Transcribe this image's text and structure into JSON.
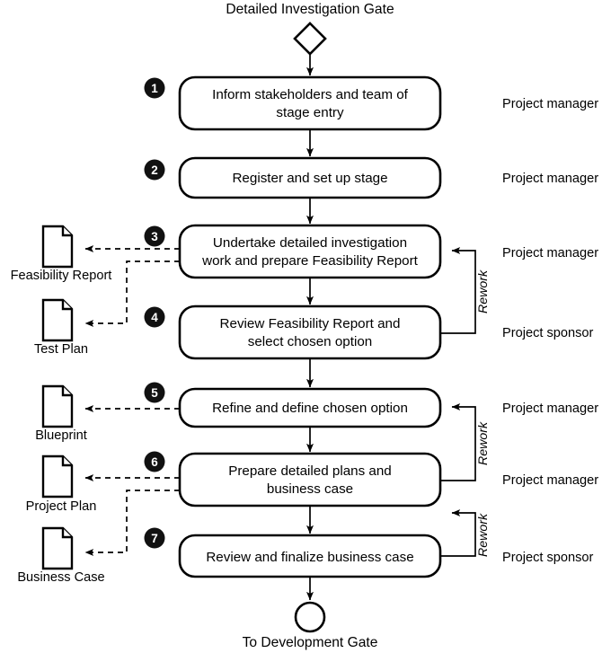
{
  "diagram": {
    "title": "Detailed Investigation Gate",
    "end_label": "To Development Gate",
    "rework_label_1": "Rework",
    "rework_label_2": "Rework",
    "colors": {
      "stroke": "#000000",
      "fill": "#ffffff",
      "badge": "#111111",
      "badge_text": "#ffffff"
    },
    "start_node": {
      "shape": "diamond",
      "name": "detailed-investigation-gate"
    },
    "end_node": {
      "shape": "circle",
      "name": "to-development-gate"
    },
    "steps": [
      {
        "number": "1",
        "line1": "Inform stakeholders and team of",
        "line2": "stage entry",
        "role": "Project manager"
      },
      {
        "number": "2",
        "line1": "Register and set up stage",
        "line2": "",
        "role": "Project manager"
      },
      {
        "number": "3",
        "line1": "Undertake detailed investigation",
        "line2": "work and prepare Feasibility Report",
        "role": "Project manager"
      },
      {
        "number": "4",
        "line1": "Review Feasibility Report and",
        "line2": "select chosen option",
        "role": "Project sponsor"
      },
      {
        "number": "5",
        "line1": "Refine and define chosen option",
        "line2": "",
        "role": "Project manager"
      },
      {
        "number": "6",
        "line1": "Prepare detailed plans and",
        "line2": "business case",
        "role": "Project manager"
      },
      {
        "number": "7",
        "line1": "Review and finalize business case",
        "line2": "",
        "role": "Project sponsor"
      }
    ],
    "artifacts": [
      {
        "label": "Feasibility Report",
        "from_step": "3"
      },
      {
        "label": "Test Plan",
        "from_step": "3"
      },
      {
        "label": "Blueprint",
        "from_step": "5"
      },
      {
        "label": "Project Plan",
        "from_step": "6"
      },
      {
        "label": "Business Case",
        "from_step": "6"
      }
    ]
  }
}
